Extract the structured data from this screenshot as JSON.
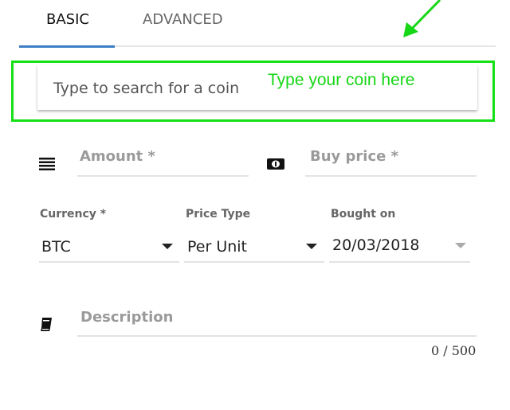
{
  "tabs": [
    {
      "label": "BASIC",
      "active": true
    },
    {
      "label": "ADVANCED",
      "active": false
    }
  ],
  "search": {
    "placeholder": "Type to search for a coin"
  },
  "annotation": {
    "text": "Type your coin here",
    "color": "#16e016"
  },
  "fields": {
    "amount": {
      "label": "Amount *",
      "icon": "list-icon"
    },
    "buy_price": {
      "label": "Buy price *",
      "icon": "money-icon"
    },
    "currency": {
      "label": "Currency *",
      "value": "BTC"
    },
    "price_type": {
      "label": "Price Type",
      "value": "Per Unit"
    },
    "bought_on": {
      "label": "Bought on",
      "value": "20/03/2018"
    },
    "description": {
      "label": "Description",
      "icon": "book-icon",
      "counter": "0 / 500"
    }
  },
  "accent": "#3c7dc4"
}
